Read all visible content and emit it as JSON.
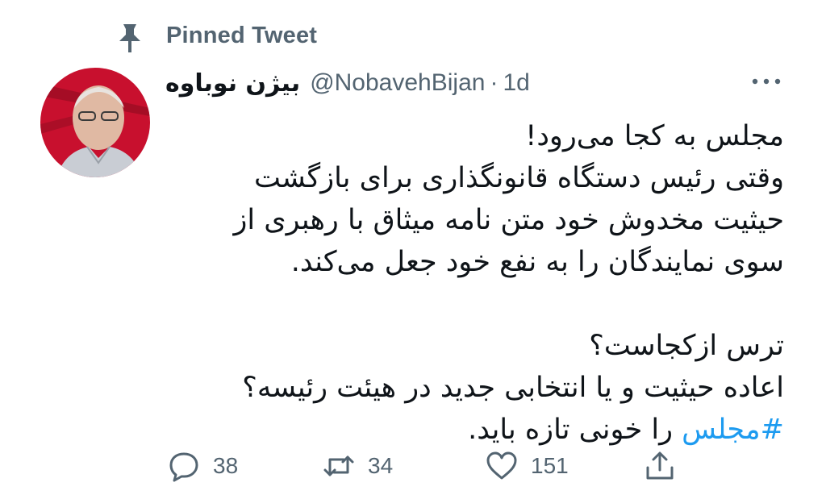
{
  "pinned": {
    "label": "Pinned Tweet",
    "icon": "pin-icon"
  },
  "author": {
    "display_name": "بیژن نوباوه",
    "handle": "@NobavehBijan",
    "separator": "·",
    "time": "1d",
    "avatar_icon": "avatar"
  },
  "more_icon": "more-horizontal-icon",
  "tweet": {
    "lines": [
      "مجلس به کجا می‌رود!",
      "وقتی رئیس دستگاه قانونگذاری برای بازگشت",
      "حیثیت مخدوش خود متن نامه میثاق با رهبری از",
      "سوی نمایندگان را به نفع خود جعل می‌کند.",
      "ترس ازکجاست؟",
      "اعاده حیثیت و یا انتخابی جدید در هیئت رئیسه؟"
    ],
    "last_line": {
      "hashtag": "#مجلس",
      "rest": " را خونی تازه باید."
    }
  },
  "actions": {
    "reply": {
      "icon": "reply-icon",
      "count": "38"
    },
    "retweet": {
      "icon": "retweet-icon",
      "count": "34"
    },
    "like": {
      "icon": "heart-icon",
      "count": "151"
    },
    "share": {
      "icon": "share-icon"
    }
  },
  "colors": {
    "text": "#0f1419",
    "muted": "#536471",
    "accent": "#1d9bf0",
    "avatar_bg": "#c8102e"
  }
}
